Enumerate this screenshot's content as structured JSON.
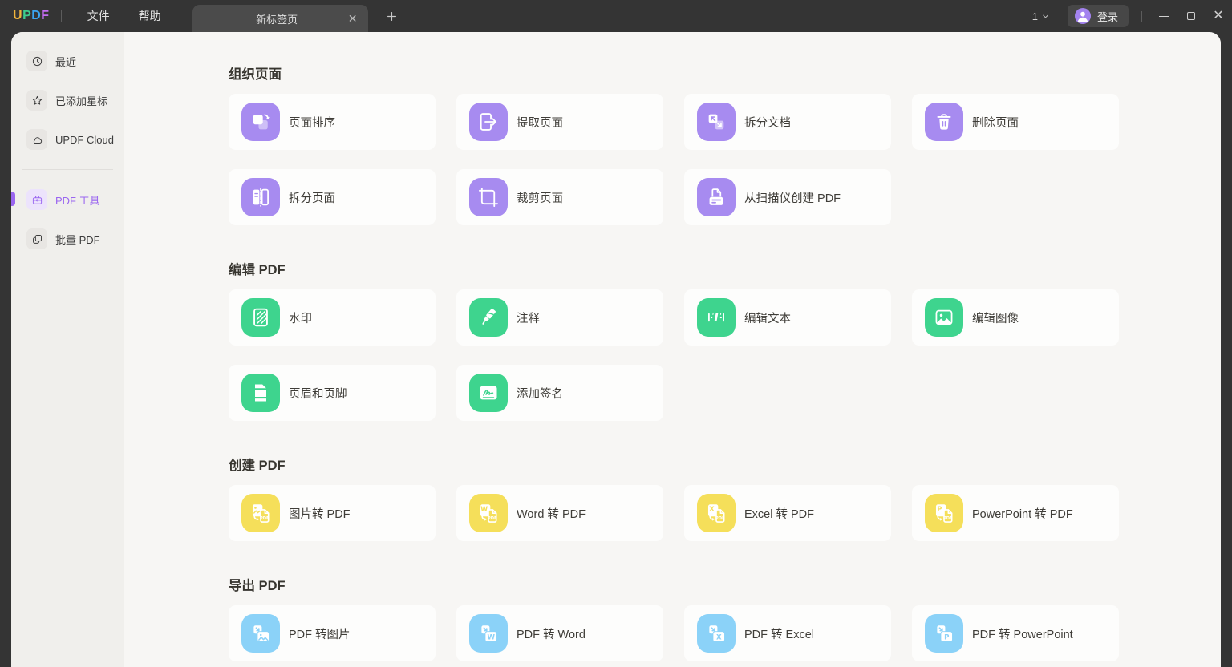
{
  "titlebar": {
    "logo": {
      "letters": [
        {
          "ch": "U",
          "color": "#f0b43c"
        },
        {
          "ch": "P",
          "color": "#3ecd8d"
        },
        {
          "ch": "D",
          "color": "#3ba5f2"
        },
        {
          "ch": "F",
          "color": "#c46cf2"
        }
      ]
    },
    "menus": [
      {
        "label": "文件"
      },
      {
        "label": "帮助"
      }
    ],
    "tab": {
      "label": "新标签页"
    },
    "tab_count": "1",
    "login_label": "登录",
    "avatar_color": "#a383ef"
  },
  "sidebar": {
    "active_color": "#9a66f0",
    "items": [
      {
        "label": "最近",
        "icon": "clock-icon",
        "active": false
      },
      {
        "label": "已添加星标",
        "icon": "star-icon",
        "active": false
      },
      {
        "label": "UPDF Cloud",
        "icon": "cloud-icon",
        "active": false
      },
      {
        "label": "PDF 工具",
        "icon": "briefcase-icon",
        "active": true
      },
      {
        "label": "批量 PDF",
        "icon": "batch-copy-icon",
        "active": false
      }
    ]
  },
  "main": {
    "sections": [
      {
        "title": "组织页面",
        "accent": "#a78bf0",
        "tools": [
          {
            "label": "页面排序",
            "icon": "sort-pages-icon"
          },
          {
            "label": "提取页面",
            "icon": "extract-pages-icon"
          },
          {
            "label": "拆分文档",
            "icon": "split-document-icon"
          },
          {
            "label": "删除页面",
            "icon": "delete-pages-icon"
          },
          {
            "label": "拆分页面",
            "icon": "split-pages-icon"
          },
          {
            "label": "裁剪页面",
            "icon": "crop-pages-icon"
          },
          {
            "label": "从扫描仪创建 PDF",
            "icon": "scanner-create-pdf-icon"
          }
        ]
      },
      {
        "title": "编辑 PDF",
        "accent": "#3ed48e",
        "tools": [
          {
            "label": "水印",
            "icon": "watermark-icon"
          },
          {
            "label": "注释",
            "icon": "annotate-icon"
          },
          {
            "label": "编辑文本",
            "icon": "edit-text-icon"
          },
          {
            "label": "编辑图像",
            "icon": "edit-image-icon"
          },
          {
            "label": "页眉和页脚",
            "icon": "header-footer-icon"
          },
          {
            "label": "添加签名",
            "icon": "add-signature-icon"
          }
        ]
      },
      {
        "title": "创建 PDF",
        "accent": "#f5df5a",
        "tools": [
          {
            "label": "图片转 PDF",
            "icon": "image-to-pdf-icon"
          },
          {
            "label": "Word 转 PDF",
            "icon": "word-to-pdf-icon"
          },
          {
            "label": "Excel 转 PDF",
            "icon": "excel-to-pdf-icon"
          },
          {
            "label": "PowerPoint 转 PDF",
            "icon": "powerpoint-to-pdf-icon"
          }
        ]
      },
      {
        "title": "导出 PDF",
        "accent": "#8bd2f8",
        "tools": [
          {
            "label": "PDF 转图片",
            "icon": "pdf-to-image-icon"
          },
          {
            "label": "PDF 转 Word",
            "icon": "pdf-to-word-icon"
          },
          {
            "label": "PDF 转 Excel",
            "icon": "pdf-to-excel-icon"
          },
          {
            "label": "PDF 转 PowerPoint",
            "icon": "pdf-to-powerpoint-icon"
          }
        ]
      }
    ]
  }
}
